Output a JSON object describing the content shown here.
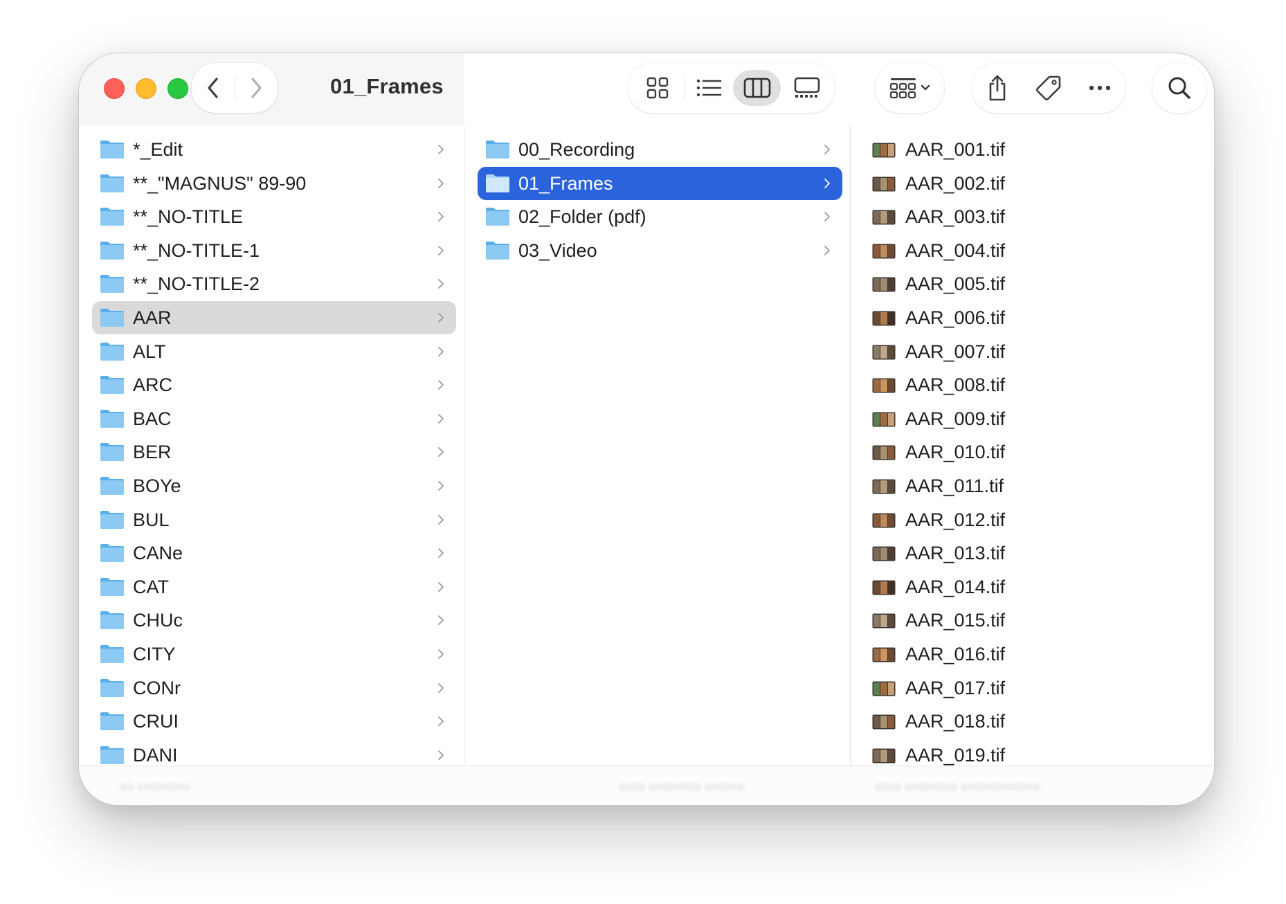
{
  "window": {
    "title": "01_Frames"
  },
  "toolbar": {
    "back_icon": "chevron-left-icon",
    "forward_icon": "chevron-right-icon",
    "view_buttons": [
      "icon-view-icon",
      "list-view-icon",
      "column-view-icon",
      "gallery-view-icon"
    ],
    "active_view": "column-view-icon",
    "group_icon": "group-grid-icon",
    "share_icon": "share-icon",
    "tag_icon": "tag-icon",
    "more_icon": "ellipsis-icon",
    "search_icon": "search-icon"
  },
  "colors": {
    "selection_active": "#2a63db",
    "selection_inactive": "#dadada",
    "folder": "#7ec3f2",
    "close": "#fe5f57",
    "minimize": "#febc2e",
    "maximize": "#28c840"
  },
  "columns": {
    "col1": {
      "selected_label": "AAR",
      "items": [
        {
          "label": "*_Edit"
        },
        {
          "label": "**_\"MAGNUS\" 89-90"
        },
        {
          "label": "**_NO-TITLE"
        },
        {
          "label": "**_NO-TITLE-1"
        },
        {
          "label": "**_NO-TITLE-2"
        },
        {
          "label": "AAR"
        },
        {
          "label": "ALT"
        },
        {
          "label": "ARC"
        },
        {
          "label": "BAC"
        },
        {
          "label": "BER"
        },
        {
          "label": "BOYe"
        },
        {
          "label": "BUL"
        },
        {
          "label": "CANe"
        },
        {
          "label": "CAT"
        },
        {
          "label": "CHUc"
        },
        {
          "label": "CITY"
        },
        {
          "label": "CONr"
        },
        {
          "label": "CRUI"
        },
        {
          "label": "DANI"
        }
      ]
    },
    "col2": {
      "selected_label": "01_Frames",
      "items": [
        {
          "label": "00_Recording"
        },
        {
          "label": "01_Frames"
        },
        {
          "label": "02_Folder (pdf)"
        },
        {
          "label": "03_Video"
        }
      ]
    },
    "col3": {
      "items": [
        {
          "label": "AAR_001.tif"
        },
        {
          "label": "AAR_002.tif"
        },
        {
          "label": "AAR_003.tif"
        },
        {
          "label": "AAR_004.tif"
        },
        {
          "label": "AAR_005.tif"
        },
        {
          "label": "AAR_006.tif"
        },
        {
          "label": "AAR_007.tif"
        },
        {
          "label": "AAR_008.tif"
        },
        {
          "label": "AAR_009.tif"
        },
        {
          "label": "AAR_010.tif"
        },
        {
          "label": "AAR_011.tif"
        },
        {
          "label": "AAR_012.tif"
        },
        {
          "label": "AAR_013.tif"
        },
        {
          "label": "AAR_014.tif"
        },
        {
          "label": "AAR_015.tif"
        },
        {
          "label": "AAR_016.tif"
        },
        {
          "label": "AAR_017.tif"
        },
        {
          "label": "AAR_018.tif"
        },
        {
          "label": "AAR_019.tif"
        }
      ]
    }
  }
}
